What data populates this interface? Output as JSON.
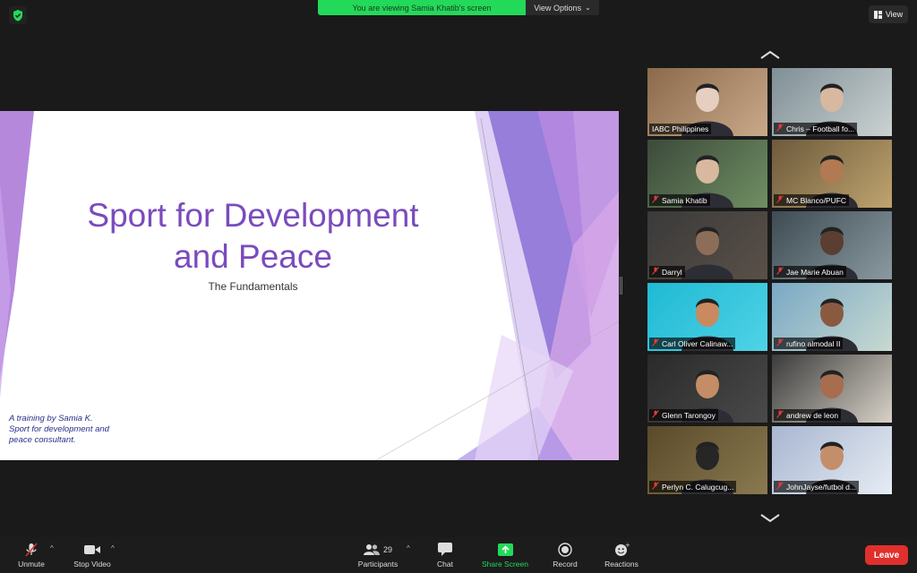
{
  "top": {
    "share_banner": "You are viewing Samia Khatib's screen",
    "view_options": "View Options",
    "view_button": "View"
  },
  "slide": {
    "title_line1": "Sport for Development",
    "title_line2": "and Peace",
    "subtitle": "The Fundamentals",
    "credit_line1": "A training by Samia K.",
    "credit_line2": "Sport for development and",
    "credit_line3": "peace consultant."
  },
  "gallery": {
    "tiles": [
      {
        "name": "IABC Philippines",
        "muted": false,
        "active": true
      },
      {
        "name": "Chris – Football fo...",
        "muted": true
      },
      {
        "name": "Samia Khatib",
        "muted": true
      },
      {
        "name": "MC Blanco/PUFC",
        "muted": true
      },
      {
        "name": "Darryl",
        "muted": true
      },
      {
        "name": "Jae Marie Abuan",
        "muted": true
      },
      {
        "name": "Carl Oliver Calinaw...",
        "muted": true
      },
      {
        "name": "rufino almodal II",
        "muted": true
      },
      {
        "name": "Glenn Tarongoy",
        "muted": true
      },
      {
        "name": "andrew de leon",
        "muted": true
      },
      {
        "name": "Perlyn C. Calugcug...",
        "muted": true
      },
      {
        "name": "JohnJayse/futbol d...",
        "muted": true
      }
    ]
  },
  "toolbar": {
    "unmute": "Unmute",
    "stop_video": "Stop Video",
    "participants_count": "29",
    "participants": "Participants",
    "chat": "Chat",
    "share_screen": "Share Screen",
    "record": "Record",
    "reactions": "Reactions",
    "leave": "Leave"
  },
  "colors": {
    "share_green": "#23d959",
    "active_tile_border": "#d7e86d",
    "leave_red": "#e0302c",
    "slide_title": "#7a4bbd"
  }
}
